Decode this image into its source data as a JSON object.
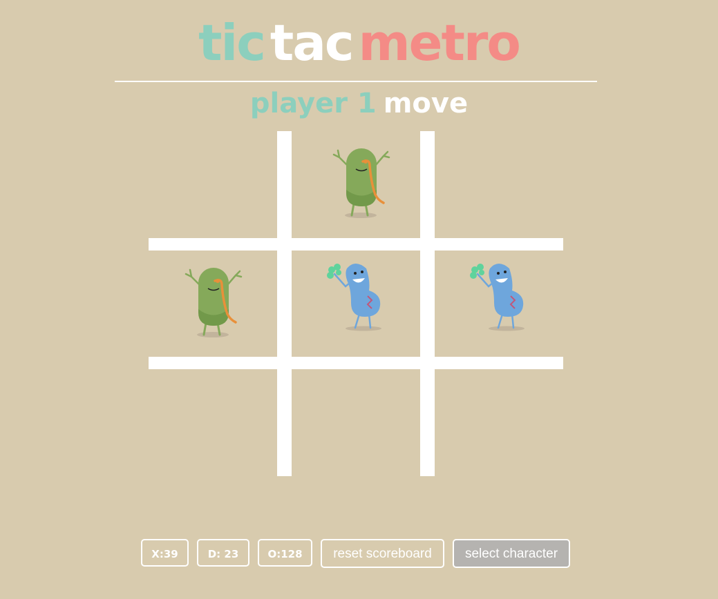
{
  "title": {
    "word1": "tic",
    "word2": "tac",
    "word3": "metro"
  },
  "status": {
    "player": "player 1",
    "action": "move"
  },
  "colors": {
    "background": "#d8cbae",
    "title_green": "#8ccfbd",
    "title_pink": "#f48b86",
    "player1_character": "#85a95a",
    "player2_character": "#6ea6dc"
  },
  "board": {
    "cells": [
      "",
      "green-bean-character",
      "",
      "green-bean-character",
      "blue-bean-character",
      "blue-bean-character",
      "",
      "",
      ""
    ]
  },
  "scoreboard": {
    "x_score": "X:39",
    "draws": "D: 23",
    "o_score": "O:128",
    "reset_label": "reset scoreboard",
    "select_label": "select character"
  }
}
